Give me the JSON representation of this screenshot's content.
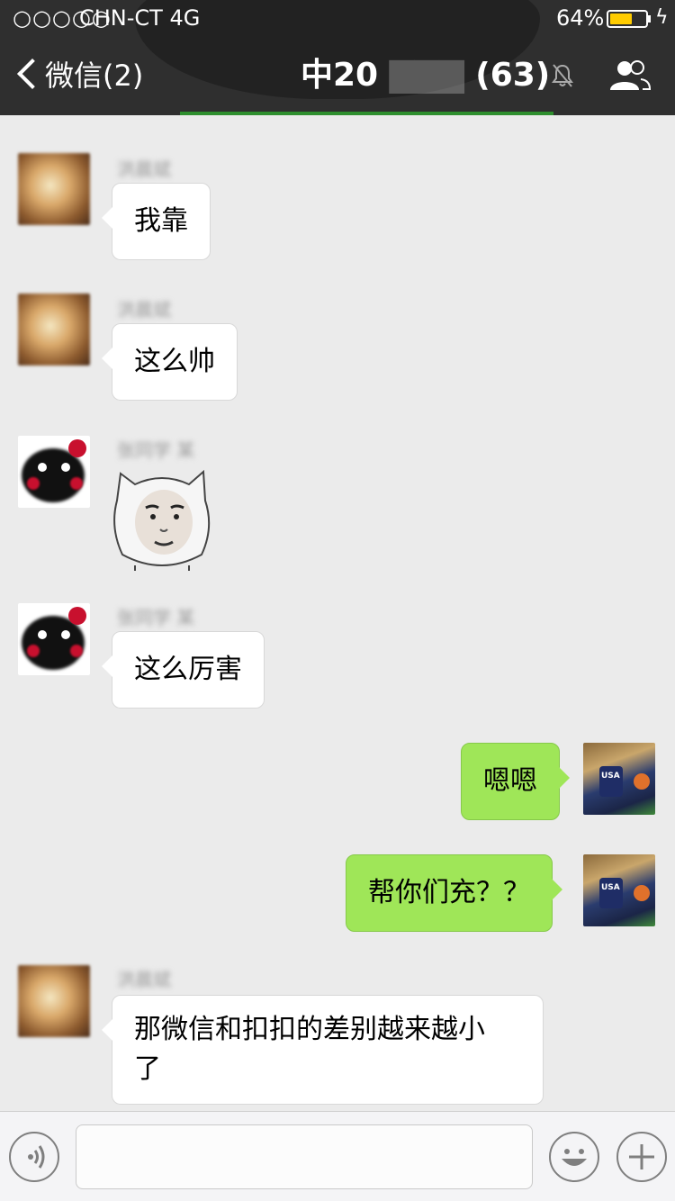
{
  "status_bar": {
    "signal": "○○○○○",
    "carrier": "CHN-CT",
    "network": "4G",
    "battery_percent": "64%",
    "battery_level": 0.64,
    "charging_icon": "bolt-icon"
  },
  "nav": {
    "back_label": "微信(2)",
    "title": "中20",
    "member_count": "(63)",
    "mute_icon": "bell-slash-icon",
    "members_icon": "people-icon"
  },
  "messages": [
    {
      "side": "left",
      "sender": "洪晨斌",
      "text": "我靠",
      "avatar": "warm-photo"
    },
    {
      "side": "left",
      "sender": "洪晨斌",
      "text": "这么帅",
      "avatar": "warm-photo"
    },
    {
      "side": "left",
      "sender": "张同学 某",
      "type": "sticker",
      "avatar": "kumamon"
    },
    {
      "side": "left",
      "sender": "张同学 某",
      "text": "这么厉害",
      "avatar": "kumamon"
    },
    {
      "side": "right",
      "text": "嗯嗯",
      "avatar": "basketball-player"
    },
    {
      "side": "right",
      "text": "帮你们充？？",
      "avatar": "basketball-player"
    },
    {
      "side": "left",
      "sender": "洪晨斌",
      "text_line1": "那微信和扣扣的差别越来越小",
      "text_line2": "了",
      "avatar": "warm-photo"
    }
  ],
  "input_bar": {
    "voice_icon": "voice-icon",
    "input_value": "",
    "emoji_icon": "smiley-icon",
    "more_icon": "plus-icon"
  }
}
